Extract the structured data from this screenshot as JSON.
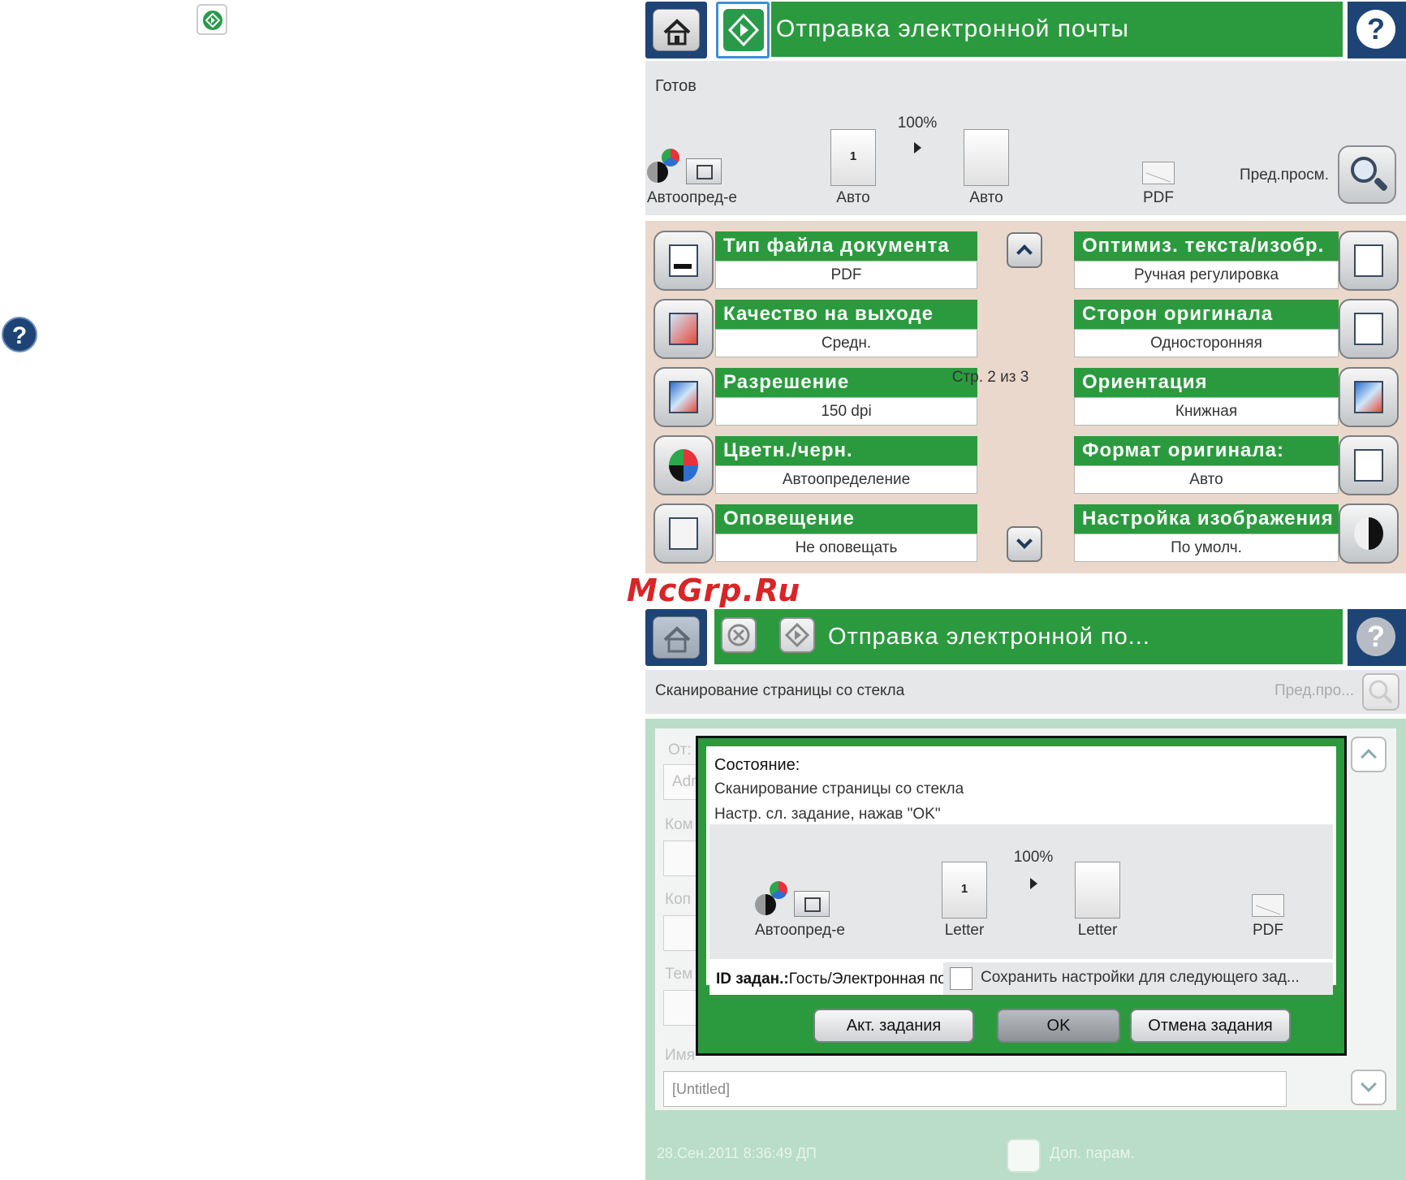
{
  "screen1": {
    "title": "Отправка электронной почты",
    "status": "Готов",
    "scale": "100%",
    "color_label": "Автоопред-е",
    "input_label": "Авто",
    "output_label": "Авто",
    "page_number": "1",
    "format_label": "PDF",
    "preview_label": "Пред.просм.",
    "page_indicator": "Стр. 2 из 3",
    "options_left": [
      {
        "title": "Тип файла документа",
        "value": "PDF",
        "icon": "document-icon"
      },
      {
        "title": "Качество на выходе",
        "value": "Средн.",
        "icon": "output-quality-icon"
      },
      {
        "title": "Разрешение",
        "value": "150 dpi",
        "icon": "resolution-icon"
      },
      {
        "title": "Цветн./черн.",
        "value": "Автоопределение",
        "icon": "color-mode-icon"
      },
      {
        "title": "Оповещение",
        "value": "Не оповещать",
        "icon": "notification-icon"
      }
    ],
    "options_right": [
      {
        "title": "Оптимиз. текста/изобр.",
        "value": "Ручная регулировка",
        "icon": "text-image-icon"
      },
      {
        "title": "Сторон оригинала",
        "value": "Односторонняя",
        "icon": "sides-icon"
      },
      {
        "title": "Ориентация",
        "value": "Книжная",
        "icon": "orientation-icon"
      },
      {
        "title": "Формат оригинала:",
        "value": "Авто",
        "icon": "original-size-icon"
      },
      {
        "title": "Настройка изображения",
        "value": "По умолч.",
        "icon": "image-adjust-icon"
      }
    ]
  },
  "watermark": "McGrp.Ru",
  "screen2": {
    "title": "Отправка электронной по...",
    "scan_status": "Сканирование страницы со стекла",
    "preview_label": "Пред.про...",
    "bg_labels": {
      "from": "От:",
      "from_field": "Adr",
      "to": "Ком",
      "cc": "Коп",
      "subject": "Тем",
      "filename": "Имя"
    },
    "filename_value": "[Untitled]",
    "timestamp": "28.Сен.2011 8:36:49 ДП",
    "more_options": "Доп. парам.",
    "dialog": {
      "heading": "Состояние:",
      "line1": "Сканирование страницы со стекла",
      "line2": "Настр. сл. задание, нажав \"OK\"",
      "scale": "100%",
      "color_label": "Автоопред-е",
      "page_number": "1",
      "input_label": "Letter",
      "output_label": "Letter",
      "format_label": "PDF",
      "job_id_label": "ID задан.:",
      "job_id_value": "Гость/Электронная по",
      "save_settings": "Сохранить настройки для следующего зад...",
      "btn_active": "Акт. задания",
      "btn_ok": "OK",
      "btn_cancel": "Отмена задания"
    }
  },
  "colors": {
    "green": "#2b9a3e",
    "navy": "#1d4475",
    "peach": "#ead8cc",
    "mint": "#b9ddc6",
    "grey": "#e6e7e8",
    "watermark": "#d82526"
  }
}
